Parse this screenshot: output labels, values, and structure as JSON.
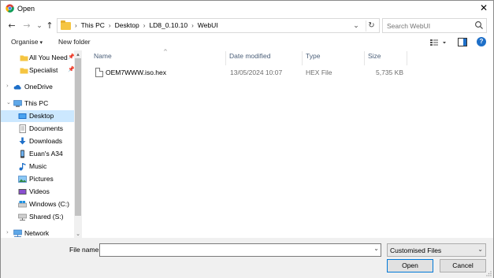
{
  "window": {
    "title": "Open",
    "close_glyph": "✕"
  },
  "nav": {
    "back_glyph": "←",
    "forward_glyph": "→",
    "recent_glyph": "⌄",
    "up_glyph": "↑",
    "breadcrumbs": [
      "This PC",
      "Desktop",
      "LD8_0.10.10",
      "WebUI"
    ],
    "search_placeholder": "Search WebUI"
  },
  "toolbar": {
    "organise_label": "Organise",
    "new_folder_label": "New folder",
    "help_label": "?"
  },
  "sidebar": {
    "items": [
      {
        "label": "All You Need",
        "icon": "folder-icon",
        "pinned": true
      },
      {
        "label": "Specialist",
        "icon": "folder-icon",
        "pinned": true
      },
      {
        "label": "OneDrive",
        "icon": "cloud-icon"
      },
      {
        "label": "This PC",
        "icon": "computer-icon"
      },
      {
        "label": "Desktop",
        "icon": "desktop-icon",
        "selected": true
      },
      {
        "label": "Documents",
        "icon": "documents-icon"
      },
      {
        "label": "Downloads",
        "icon": "download-icon"
      },
      {
        "label": "Euan's A34",
        "icon": "phone-icon"
      },
      {
        "label": "Music",
        "icon": "music-icon"
      },
      {
        "label": "Pictures",
        "icon": "pictures-icon"
      },
      {
        "label": "Videos",
        "icon": "videos-icon"
      },
      {
        "label": "Windows (C:)",
        "icon": "drive-icon"
      },
      {
        "label": "Shared (S:)",
        "icon": "network-drive-icon"
      },
      {
        "label": "Network",
        "icon": "network-icon"
      }
    ]
  },
  "files": {
    "columns": [
      "Name",
      "Date modified",
      "Type",
      "Size"
    ],
    "rows": [
      {
        "name": "OEM7WWW.iso.hex",
        "date": "13/05/2024 10:07",
        "type": "HEX File",
        "size": "5,735 KB"
      }
    ]
  },
  "bottom": {
    "filename_label": "File name:",
    "filename_value": "",
    "filter_value": "Customised Files",
    "open_label": "Open",
    "cancel_label": "Cancel"
  },
  "colors": {
    "accent": "#0078d7",
    "selection": "#cce8ff",
    "folder": "#f5c542"
  }
}
